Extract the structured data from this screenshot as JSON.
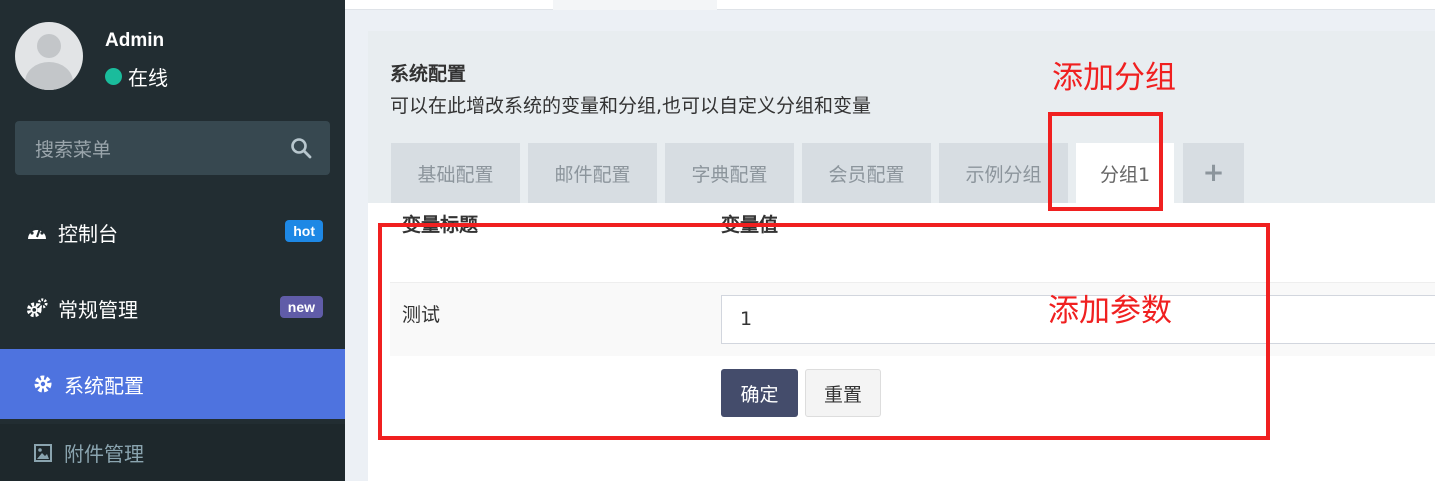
{
  "user": {
    "name": "Admin",
    "status": "在线",
    "status_color": "#1abc9c"
  },
  "search": {
    "placeholder": "搜索菜单"
  },
  "menu": [
    {
      "label": "控制台",
      "icon": "dashboard-icon",
      "badge": "hot",
      "badge_color": "#1e88e5"
    },
    {
      "label": "常规管理",
      "icon": "cogs-icon",
      "badge": "new",
      "badge_color": "#605ca8"
    },
    {
      "label": "系统配置",
      "icon": "gear-icon",
      "active": true
    },
    {
      "label": "附件管理",
      "icon": "image-icon"
    }
  ],
  "panel": {
    "title": "系统配置",
    "description": "可以在此增改系统的变量和分组,也可以自定义分组和变量",
    "tabs": [
      "基础配置",
      "邮件配置",
      "字典配置",
      "会员配置",
      "示例分组",
      "分组1"
    ],
    "active_tab": "分组1",
    "add_tab": "+"
  },
  "table": {
    "headers": [
      "变量标题",
      "变量值"
    ],
    "rows": [
      {
        "title": "测试",
        "value": "1"
      }
    ]
  },
  "buttons": {
    "submit": "确定",
    "reset": "重置"
  },
  "annotations": {
    "add_group": "添加分组",
    "add_param": "添加参数"
  },
  "colors": {
    "sidebar_bg": "#222d32",
    "active_menu": "#4e73df",
    "annotation": "#f02020",
    "primary_button": "#444c6b"
  }
}
